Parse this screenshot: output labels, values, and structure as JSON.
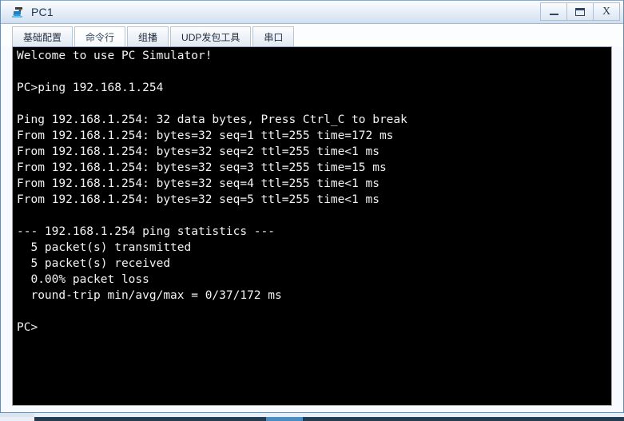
{
  "window": {
    "title": "PC1",
    "icon": "pc-simulator-icon",
    "controls": {
      "minimize_label": "–",
      "maximize_label": "▭",
      "close_label": "X"
    }
  },
  "tabs": [
    {
      "label": "基础配置",
      "name": "tab-basic-config",
      "selected": false
    },
    {
      "label": "命令行",
      "name": "tab-command-line",
      "selected": true
    },
    {
      "label": "组播",
      "name": "tab-multicast",
      "selected": false
    },
    {
      "label": "UDP发包工具",
      "name": "tab-udp-packet-tool",
      "selected": false
    },
    {
      "label": "串口",
      "name": "tab-serial-port",
      "selected": false
    }
  ],
  "terminal": {
    "lines": [
      "Welcome to use PC Simulator!",
      "",
      "PC>ping 192.168.1.254",
      "",
      "Ping 192.168.1.254: 32 data bytes, Press Ctrl_C to break",
      "From 192.168.1.254: bytes=32 seq=1 ttl=255 time=172 ms",
      "From 192.168.1.254: bytes=32 seq=2 ttl=255 time<1 ms",
      "From 192.168.1.254: bytes=32 seq=3 ttl=255 time=15 ms",
      "From 192.168.1.254: bytes=32 seq=4 ttl=255 time<1 ms",
      "From 192.168.1.254: bytes=32 seq=5 ttl=255 time<1 ms",
      "",
      "--- 192.168.1.254 ping statistics ---",
      "  5 packet(s) transmitted",
      "  5 packet(s) received",
      "  0.00% packet loss",
      "  round-trip min/avg/max = 0/37/172 ms",
      "",
      "PC>"
    ],
    "background_color": "#000000",
    "text_color": "#f2f2f2"
  },
  "theme": {
    "titlebar_accent": "#cfe0f1",
    "frame_border": "#6f8ca8",
    "taskbar_color": "#253b50",
    "taskbar_active_color": "#4a8cc4"
  }
}
